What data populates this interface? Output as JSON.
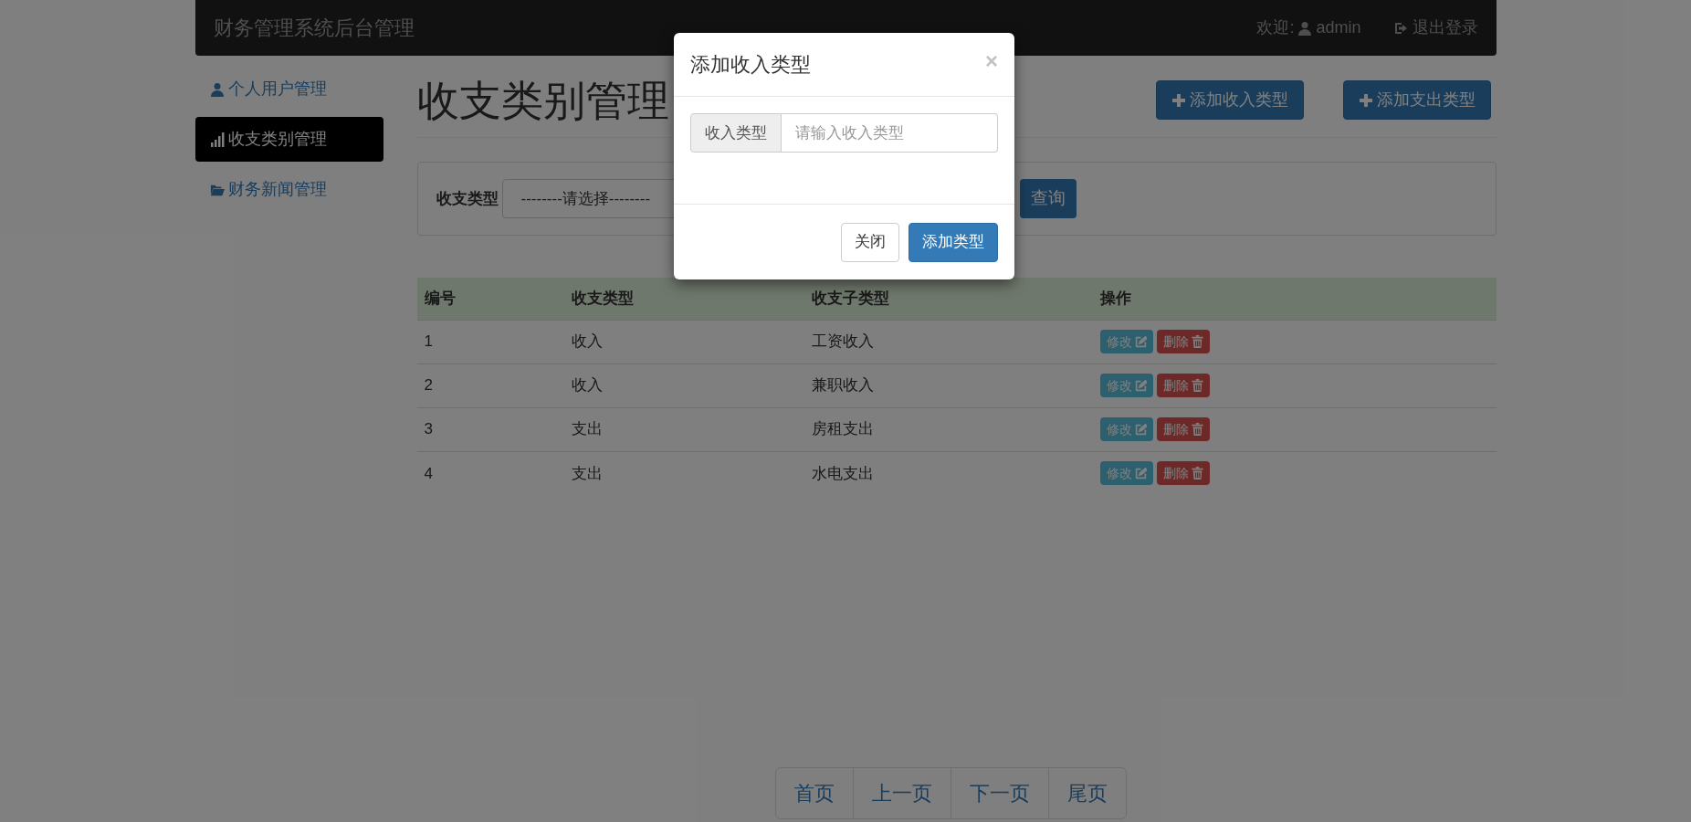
{
  "navbar": {
    "brand": "财务管理系统后台管理",
    "welcome": "欢迎:",
    "user": "admin",
    "logout": "退出登录"
  },
  "sidebar": {
    "items": [
      {
        "label": "个人用户管理",
        "selected": false
      },
      {
        "label": "收支类别管理",
        "selected": true
      },
      {
        "label": "财务新闻管理",
        "selected": false
      }
    ]
  },
  "page": {
    "title": "收支类别管理",
    "actions": [
      "添加收入类型",
      "添加支出类型"
    ]
  },
  "filter": {
    "label": "收支类型",
    "select_value": "--------请选择--------",
    "search_button": "查询"
  },
  "table": {
    "columns": [
      "编号",
      "收支类型",
      "收支子类型",
      "操作"
    ],
    "rows": [
      {
        "id": "1",
        "type": "收入",
        "subtype": "工资收入",
        "edit": "修改",
        "delete": "删除"
      },
      {
        "id": "2",
        "type": "收入",
        "subtype": "兼职收入",
        "edit": "修改",
        "delete": "删除"
      },
      {
        "id": "3",
        "type": "支出",
        "subtype": "房租支出",
        "edit": "修改",
        "delete": "删除"
      },
      {
        "id": "4",
        "type": "支出",
        "subtype": "水电支出",
        "edit": "修改",
        "delete": "删除"
      }
    ]
  },
  "pagination": [
    "首页",
    "上一页",
    "下一页",
    "尾页"
  ],
  "modal": {
    "title": "添加收入类型",
    "close": "×",
    "field_label": "收入类型",
    "placeholder": "请输入收入类型",
    "buttons": [
      {
        "label": "关闭",
        "kind": "default"
      },
      {
        "label": "添加类型",
        "kind": "primary"
      }
    ]
  }
}
